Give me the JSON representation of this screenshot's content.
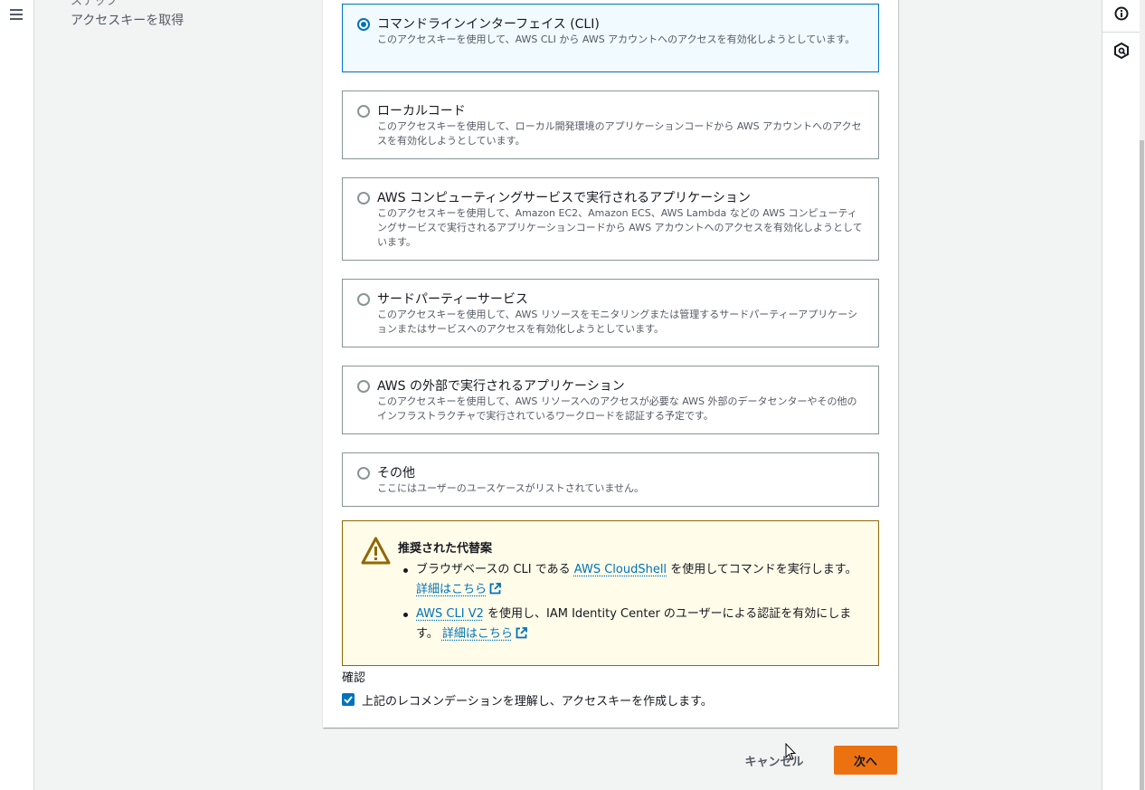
{
  "nav": {
    "step_prev": "ステップ",
    "step_current": "アクセスキーを取得"
  },
  "options": [
    {
      "title": "コマンドラインインターフェイス (CLI)",
      "desc": "このアクセスキーを使用して、AWS CLI から AWS アカウントへのアクセスを有効化しようとしています。",
      "selected": true
    },
    {
      "title": "ローカルコード",
      "desc": "このアクセスキーを使用して、ローカル開発環境のアプリケーションコードから AWS アカウントへのアクセスを有効化しようとしています。",
      "selected": false
    },
    {
      "title": "AWS コンピューティングサービスで実行されるアプリケーション",
      "desc": "このアクセスキーを使用して、Amazon EC2、Amazon ECS、AWS Lambda などの AWS コンピューティングサービスで実行されるアプリケーションコードから AWS アカウントへのアクセスを有効化しようとしています。",
      "selected": false
    },
    {
      "title": "サードパーティーサービス",
      "desc": "このアクセスキーを使用して、AWS リソースをモニタリングまたは管理するサードパーティーアプリケーションまたはサービスへのアクセスを有効化しようとしています。",
      "selected": false
    },
    {
      "title": "AWS の外部で実行されるアプリケーション",
      "desc": "このアクセスキーを使用して、AWS リソースへのアクセスが必要な AWS 外部のデータセンターやその他のインフラストラクチャで実行されているワークロードを認証する予定です。",
      "selected": false
    },
    {
      "title": "その他",
      "desc": "ここにはユーザーのユースケースがリストされていません。",
      "selected": false
    }
  ],
  "warning": {
    "title": "推奨された代替案",
    "item1_pre": "ブラウザベースの CLI である ",
    "item1_link": "AWS CloudShell",
    "item1_post": " を使用してコマンドを実行します。 ",
    "item2_link": "AWS CLI V2",
    "item2_post": " を使用し、IAM Identity Center のユーザーによる認証を有効にします。 ",
    "learn_more": "詳細はこちら"
  },
  "confirm": {
    "label": "確認",
    "checkbox_text": "上記のレコメンデーションを理解し、アクセスキーを作成します。",
    "checked": true
  },
  "footer": {
    "cancel": "キャンセル",
    "next": "次へ"
  },
  "colors": {
    "accent": "#0073bb",
    "primary_button": "#ec7211",
    "warning_border": "#906806",
    "warning_bg": "#fffce9"
  }
}
